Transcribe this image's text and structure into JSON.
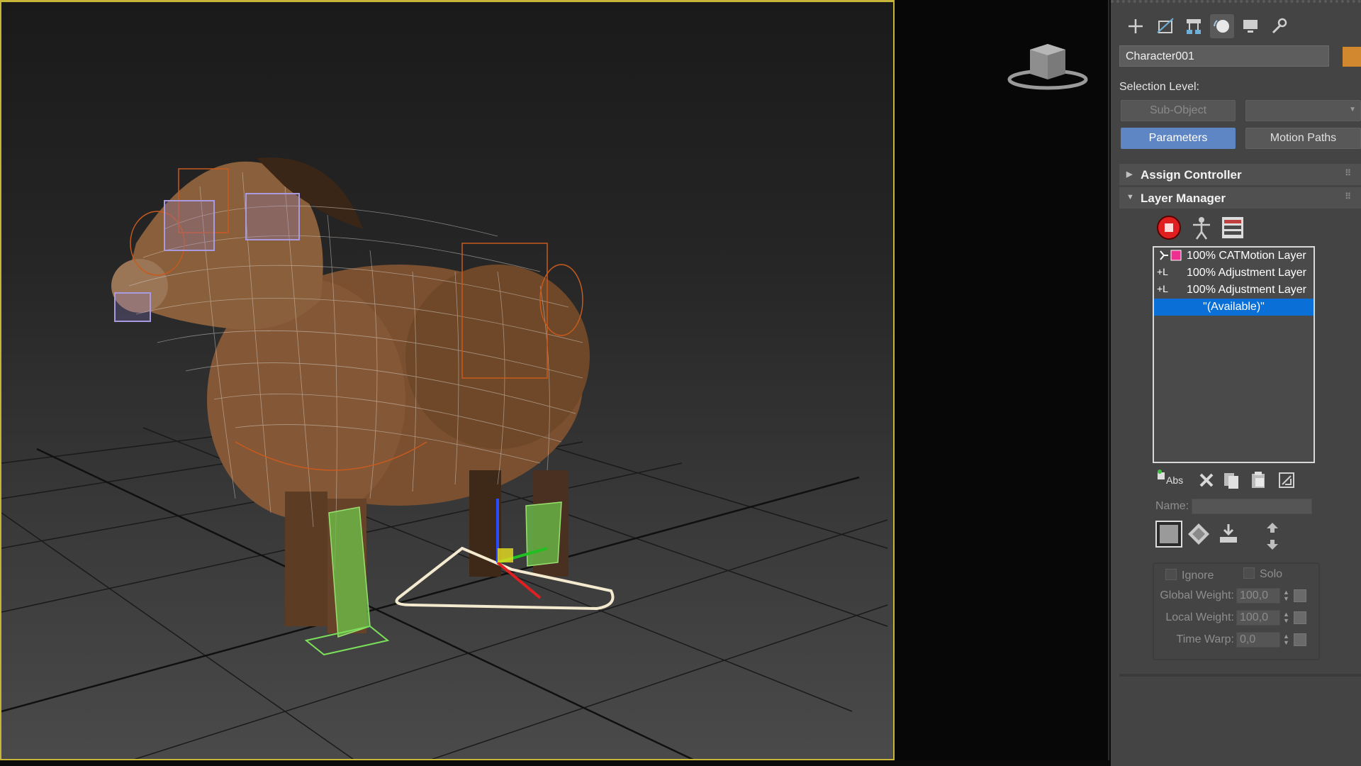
{
  "panel": {
    "tabs": [
      {
        "icon": "create-plus-icon"
      },
      {
        "icon": "modify-icon"
      },
      {
        "icon": "hierarchy-icon"
      },
      {
        "icon": "motion-icon"
      },
      {
        "icon": "display-monitor-icon"
      },
      {
        "icon": "utilities-wrench-icon"
      }
    ],
    "object_name": "Character001",
    "color_swatch": "#d2882f",
    "selection_level_label": "Selection Level:",
    "subobject_label": "Sub-Object",
    "parameters_label": "Parameters",
    "motion_paths_label": "Motion Paths",
    "assign_controller_label": "Assign Controller",
    "layer_manager_label": "Layer Manager",
    "layers": [
      {
        "lead": "",
        "text": "100% CATMotion Layer"
      },
      {
        "lead": "+L",
        "text": "100% Adjustment Layer"
      },
      {
        "lead": "+L",
        "text": "100% Adjustment Layer"
      },
      {
        "lead": "",
        "text": "\"(Available)\""
      }
    ],
    "abs_label": "Abs",
    "name_label": "Name:",
    "ignore_label": "Ignore",
    "solo_label": "Solo",
    "global_weight_label": "Global Weight:",
    "global_weight_value": "100,0",
    "local_weight_label": "Local Weight:",
    "local_weight_value": "100,0",
    "time_warp_label": "Time Warp:",
    "time_warp_value": "0,0"
  },
  "colors": {
    "viewport_border": "#c9b43a",
    "active_button": "#5e86c4",
    "selected_row": "#0a6fd6",
    "record_red": "#e02020"
  }
}
